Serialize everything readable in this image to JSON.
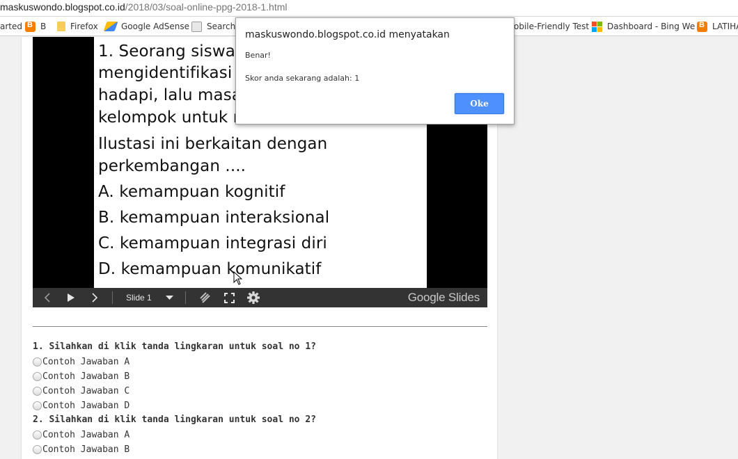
{
  "url": {
    "host": "maskuswondo.blogspot.co.id",
    "path": "/2018/03/soal-online-ppg-2018-1.html"
  },
  "bookmarks": [
    {
      "label": "arted",
      "icon": "none"
    },
    {
      "label": "B",
      "icon": "blogger-icon"
    },
    {
      "label": "Firefox",
      "icon": "folder-icon"
    },
    {
      "label": "Google AdSense",
      "icon": "adsense-icon"
    },
    {
      "label": "Search",
      "icon": "search-console-icon"
    },
    {
      "label": "obile-Friendly Test",
      "icon": "none"
    },
    {
      "label": "Dashboard - Bing We",
      "icon": "microsoft-icon"
    },
    {
      "label": "LATIHA",
      "icon": "blogger-icon"
    }
  ],
  "slide": {
    "lines": [
      "1. Seorang siswa d",
      "mengidentifikasi m",
      "hadapi, lalu masala",
      "kelompok untuk m",
      "Ilustasi ini berkaitan dengan",
      "perkembangan ....",
      "A. kemampuan kognitif",
      "B. kemampuan interaksional",
      "C. kemampuan integrasi diri",
      "D. kemampuan komunikatif"
    ]
  },
  "slide_controls": {
    "slide_label": "Slide 1",
    "brand": "Google Slides"
  },
  "quiz": {
    "q1": "1. Silahkan di klik tanda lingkaran untuk soal no 1?",
    "q1_options": [
      "Contoh Jawaban A",
      "Contoh Jawaban B",
      "Contoh Jawaban C",
      "Contoh Jawaban D"
    ],
    "q2": "2. Silahkan di klik tanda lingkaran untuk soal no 2?",
    "q2_options": [
      "Contoh Jawaban A",
      "Contoh Jawaban B"
    ]
  },
  "dialog": {
    "title": "maskuswondo.blogspot.co.id menyatakan",
    "message1": "Benar!",
    "message2": "Skor anda sekarang adalah: 1",
    "ok_label": "Oke"
  },
  "colors": {
    "accent": "#4d90fe",
    "slides_bg": "#000000",
    "controls_bg": "#333333"
  }
}
